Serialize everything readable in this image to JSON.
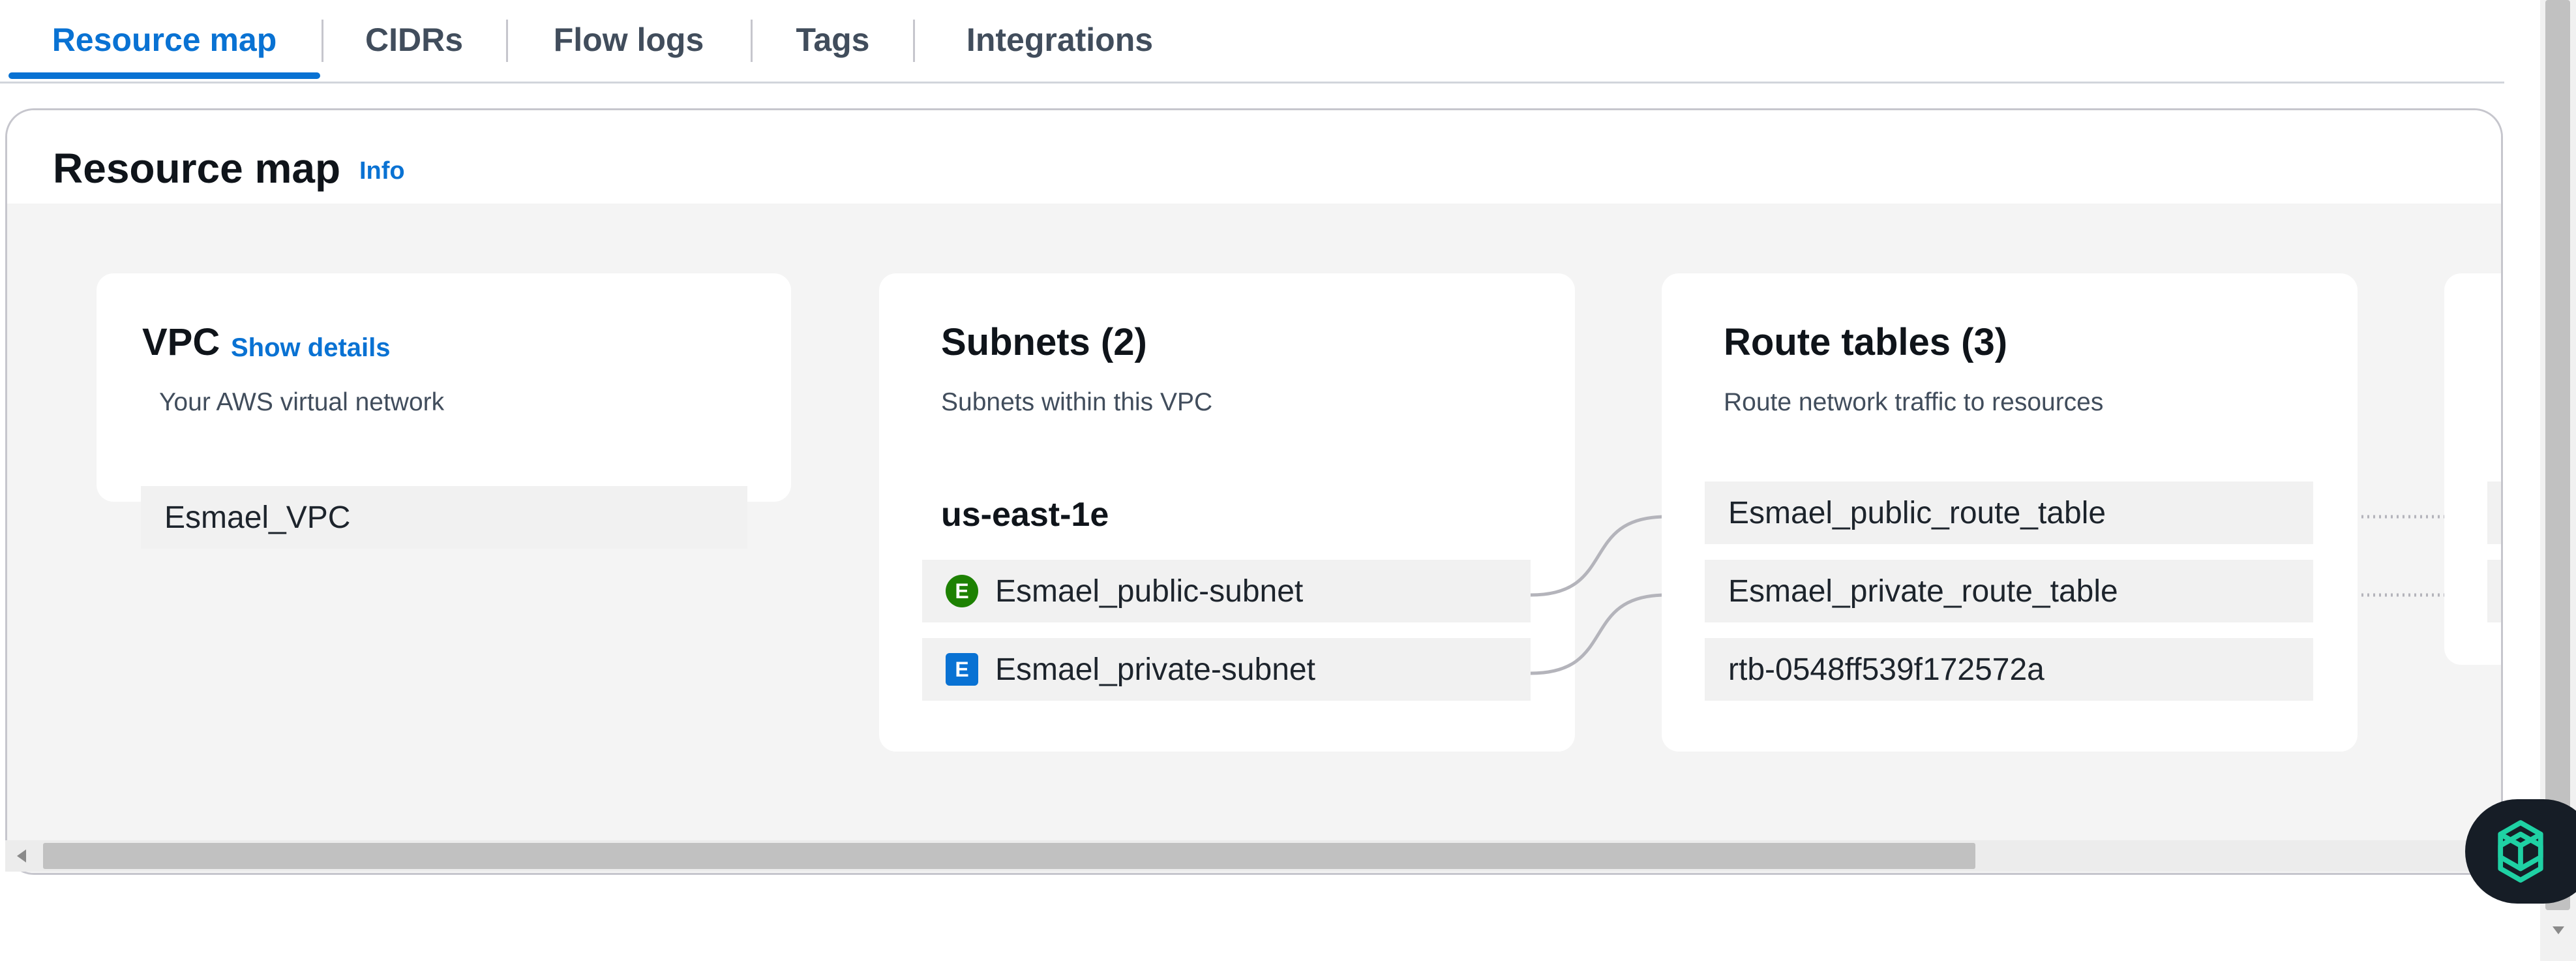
{
  "tabs": [
    {
      "label": "Resource map",
      "active": true
    },
    {
      "label": "CIDRs",
      "active": false
    },
    {
      "label": "Flow logs",
      "active": false
    },
    {
      "label": "Tags",
      "active": false
    },
    {
      "label": "Integrations",
      "active": false
    }
  ],
  "panel": {
    "title": "Resource map",
    "info_link": "Info"
  },
  "vpc": {
    "title": "VPC",
    "show_details": "Show details",
    "description": "Your AWS virtual network",
    "name": "Esmael_VPC"
  },
  "subnets": {
    "title": "Subnets (2)",
    "description": "Subnets within this VPC",
    "az": "us-east-1e",
    "items": [
      {
        "badge": "E",
        "name": "Esmael_public-subnet",
        "color": "#1d8102"
      },
      {
        "badge": "E",
        "name": "Esmael_private-subnet",
        "color": "#0972d3"
      }
    ]
  },
  "route_tables": {
    "title": "Route tables (3)",
    "description": "Route network traffic to resources",
    "items": [
      {
        "name": "Esmael_public_route_table"
      },
      {
        "name": "Esmael_private_route_table"
      },
      {
        "name": "rtb-0548ff539f172572a"
      }
    ]
  },
  "colors": {
    "accent": "#0972d3",
    "public_badge": "#1d8102",
    "private_badge": "#0972d3",
    "connector": "#b4b4bb"
  },
  "icons": {
    "assistant": "ai-assistant-knot-icon",
    "scroll_left": "scroll-left-arrow-icon",
    "scroll_down": "scroll-down-arrow-icon"
  }
}
